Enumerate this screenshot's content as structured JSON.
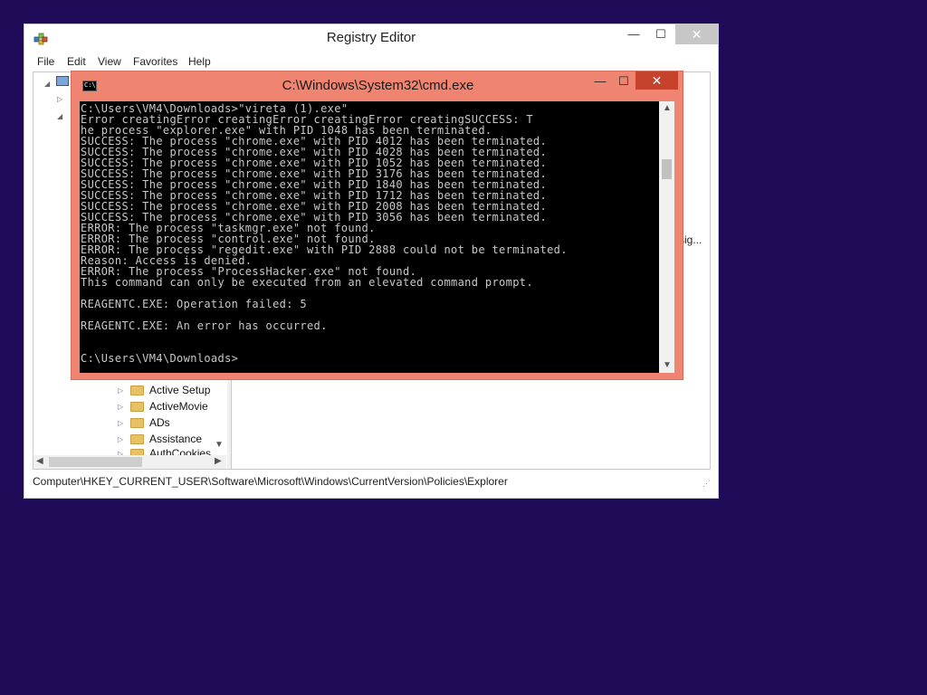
{
  "registry_editor": {
    "title": "Registry Editor",
    "window_controls": {
      "minimize": "—",
      "maximize": "☐",
      "close": "✕"
    },
    "menu": [
      "File",
      "Edit",
      "View",
      "Favorites",
      "Help"
    ],
    "tree_items": [
      "Active Setup",
      "ActiveMovie",
      "ADs",
      "Assistance",
      "AuthCookies"
    ],
    "right_pane_partial_text": "sig...",
    "status_path": "Computer\\HKEY_CURRENT_USER\\Software\\Microsoft\\Windows\\CurrentVersion\\Policies\\Explorer"
  },
  "cmd": {
    "title": "C:\\Windows\\System32\\cmd.exe",
    "icon_text": "C:\\",
    "window_controls": {
      "minimize": "—",
      "maximize": "☐",
      "close": "✕"
    },
    "lines": [
      "C:\\Users\\VM4\\Downloads>\"vireta (1).exe\"",
      "Error creatingError creatingError creatingError creatingSUCCESS: T",
      "he process \"explorer.exe\" with PID 1048 has been terminated.",
      "SUCCESS: The process \"chrome.exe\" with PID 4012 has been terminated.",
      "SUCCESS: The process \"chrome.exe\" with PID 4028 has been terminated.",
      "SUCCESS: The process \"chrome.exe\" with PID 1052 has been terminated.",
      "SUCCESS: The process \"chrome.exe\" with PID 3176 has been terminated.",
      "SUCCESS: The process \"chrome.exe\" with PID 1840 has been terminated.",
      "SUCCESS: The process \"chrome.exe\" with PID 1712 has been terminated.",
      "SUCCESS: The process \"chrome.exe\" with PID 2008 has been terminated.",
      "SUCCESS: The process \"chrome.exe\" with PID 3056 has been terminated.",
      "ERROR: The process \"taskmgr.exe\" not found.",
      "ERROR: The process \"control.exe\" not found.",
      "ERROR: The process \"regedit.exe\" with PID 2888 could not be terminated.",
      "Reason: Access is denied.",
      "ERROR: The process \"ProcessHacker.exe\" not found.",
      "This command can only be executed from an elevated command prompt.",
      "",
      "REAGENTC.EXE: Operation failed: 5",
      "",
      "REAGENTC.EXE: An error has occurred.",
      "",
      "",
      "C:\\Users\\VM4\\Downloads>"
    ]
  },
  "colors": {
    "desktop": "#1f0a57",
    "cmd_frame": "#ef8470",
    "cmd_close": "#c7422c",
    "console_bg": "#000000",
    "console_text": "#c8c8c8"
  }
}
